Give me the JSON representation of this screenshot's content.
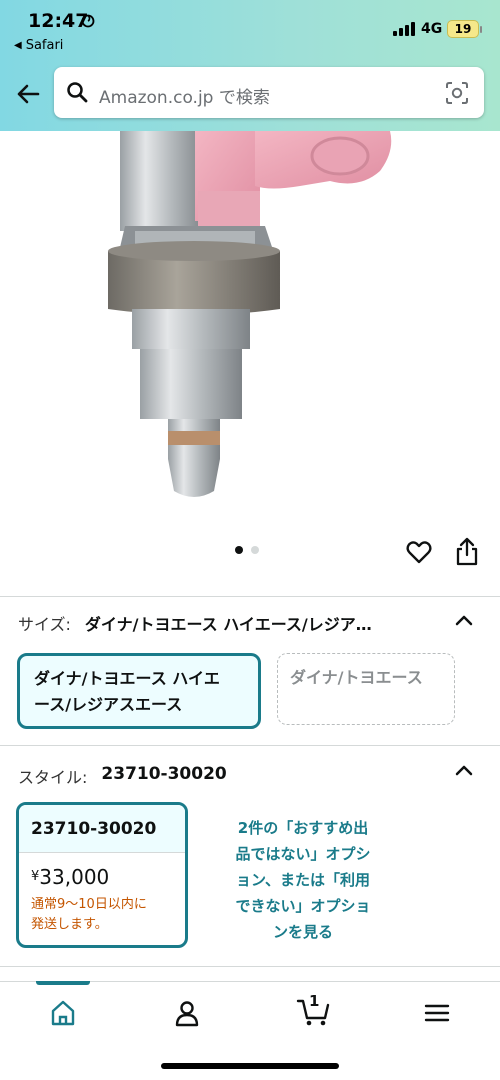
{
  "status_bar": {
    "time": "12:47",
    "back_app": "Safari",
    "network": "4G",
    "battery": "19"
  },
  "search": {
    "placeholder": "Amazon.co.jp で検索"
  },
  "carousel": {
    "total": 2,
    "active": 1
  },
  "size": {
    "label": "サイズ:",
    "value": "ダイナ/トヨエース ハイエース/レジア…",
    "options": [
      {
        "line1": "ダイナ/トヨエース ハイエ",
        "line2": "ース/レジアスエース",
        "selected": true
      },
      {
        "line1": "ダイナ/トヨエース",
        "selected": false
      }
    ]
  },
  "style": {
    "label": "スタイル:",
    "value": "23710-30020",
    "card": {
      "title": "23710-30020",
      "price_symbol": "¥",
      "price": "33,000",
      "delivery_line1": "通常9～10日以内に",
      "delivery_line2": "発送します。"
    },
    "more_options": [
      "2件の「おすすめ出",
      "品ではない」オプシ",
      "ョン、または「利用",
      "できない」オプショ",
      "ンを見る"
    ]
  },
  "nav": {
    "cart_count": "1"
  },
  "colors": {
    "accent": "#1a7b8a",
    "price_note": "#c45500",
    "header_start": "#82d8e3",
    "header_end": "#a8e6cf"
  }
}
